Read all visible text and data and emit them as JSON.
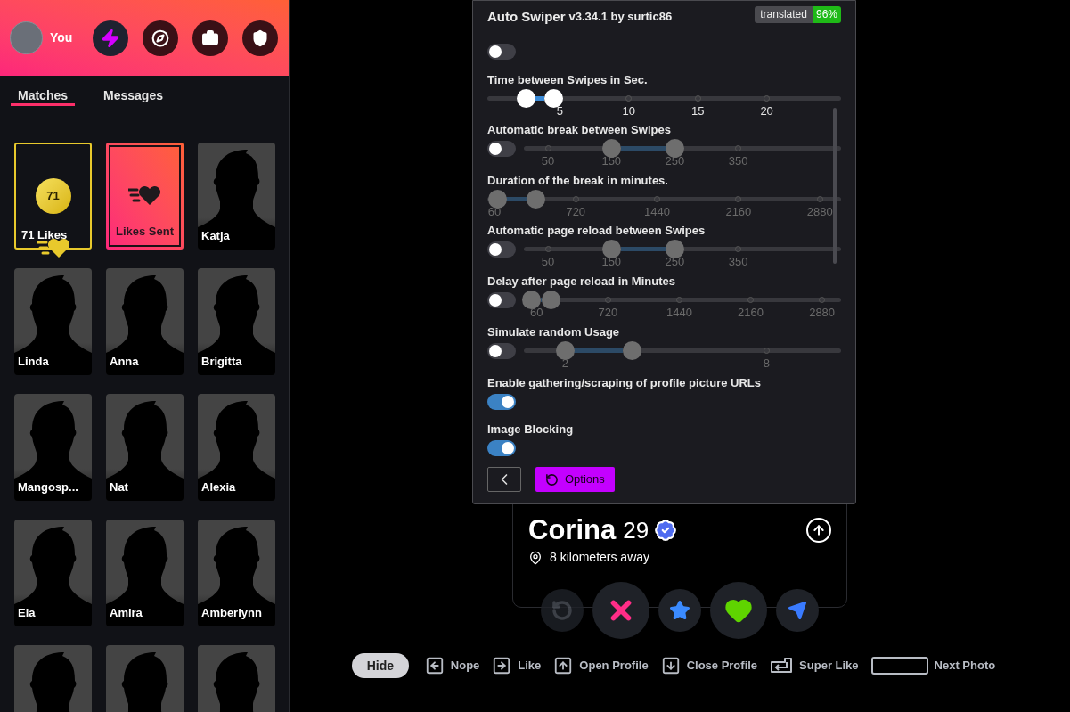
{
  "sidebar": {
    "profile": {
      "name": "You"
    },
    "nav_buttons": [
      {
        "kind": "bolt",
        "selected": true
      },
      {
        "kind": "compass",
        "selected": false
      },
      {
        "kind": "briefcase",
        "selected": false
      },
      {
        "kind": "shield",
        "selected": false
      }
    ],
    "tabs": [
      {
        "label": "Matches",
        "selected": true
      },
      {
        "label": "Messages",
        "selected": false
      }
    ],
    "matches": [
      {
        "kind": "likes",
        "count": "71",
        "label": "71 Likes"
      },
      {
        "kind": "likes_sent",
        "label": "Likes Sent"
      },
      {
        "kind": "person",
        "name": "Katja"
      },
      {
        "kind": "person",
        "name": "Linda"
      },
      {
        "kind": "person",
        "name": "Anna"
      },
      {
        "kind": "person",
        "name": "Brigitta"
      },
      {
        "kind": "person",
        "name": "Mangosp..."
      },
      {
        "kind": "person",
        "name": "Nat"
      },
      {
        "kind": "person",
        "name": "Alexia"
      },
      {
        "kind": "person",
        "name": "Ela"
      },
      {
        "kind": "person",
        "name": "Amira"
      },
      {
        "kind": "person",
        "name": "Amberlynn"
      },
      {
        "kind": "person"
      },
      {
        "kind": "person"
      },
      {
        "kind": "person"
      }
    ]
  },
  "auto_swiper": {
    "title": "Auto Swiper",
    "byline": "v3.34.1 by surtic86",
    "badge": {
      "label": "translated",
      "value": "96%"
    },
    "enabled": false,
    "settings": [
      {
        "kind": "slider",
        "label": "Time between Swipes in Sec.",
        "disabled": false,
        "thumbs": [
          {
            "level": 0.109
          },
          {
            "level": 0.187
          }
        ],
        "ticks": [
          "5",
          "10",
          "15",
          "20"
        ]
      },
      {
        "kind": "toggle_slider",
        "label": "Automatic break between Swipes",
        "on": false,
        "thumbs": [
          {
            "level": 0.277
          },
          {
            "level": 0.477
          }
        ],
        "ticks": [
          "50",
          "150",
          "250",
          "350"
        ]
      },
      {
        "kind": "slider",
        "label": "Duration of the break in minutes.",
        "disabled": true,
        "thumbs": [
          {
            "level": 0.028
          },
          {
            "level": 0.137
          }
        ],
        "ticks": [
          "60",
          "720",
          "1440",
          "2160",
          "2880"
        ]
      },
      {
        "kind": "toggle_slider",
        "label": "Automatic page reload between Swipes",
        "on": false,
        "thumbs": [
          {
            "level": 0.277
          },
          {
            "level": 0.477
          }
        ],
        "ticks": [
          "50",
          "150",
          "250",
          "350"
        ]
      },
      {
        "kind": "toggle_slider",
        "label": "Delay after page reload in Minutes",
        "on": false,
        "thumbs": [
          {
            "level": 0.025
          },
          {
            "level": 0.085
          }
        ],
        "ticks": [
          "60",
          "720",
          "1440",
          "2160",
          "2880"
        ]
      },
      {
        "kind": "toggle_slider",
        "label": "Simulate random Usage",
        "on": false,
        "thumbs": [
          {
            "level": 0.13
          },
          {
            "level": 0.34
          }
        ],
        "ticks": [
          "2",
          "8"
        ]
      },
      {
        "kind": "toggle",
        "label": "Enable gathering/scraping of profile picture URLs",
        "on": true
      },
      {
        "kind": "toggle",
        "label": "Image Blocking",
        "on": true
      }
    ],
    "options_button": "Options"
  },
  "profile_card": {
    "name": "Corina",
    "age": "29",
    "verified": true,
    "distance": "8 kilometers away"
  },
  "actions": [
    {
      "kind": "rewind",
      "disabled": true
    },
    {
      "kind": "nope",
      "disabled": false
    },
    {
      "kind": "super_like",
      "disabled": false
    },
    {
      "kind": "like",
      "disabled": false
    },
    {
      "kind": "boost",
      "disabled": false
    }
  ],
  "shortcuts": {
    "hide_button": "Hide",
    "keys": [
      {
        "kind": "left",
        "label": "Nope"
      },
      {
        "kind": "right",
        "label": "Like"
      },
      {
        "kind": "up",
        "label": "Open Profile"
      },
      {
        "kind": "down",
        "label": "Close Profile"
      },
      {
        "kind": "enter",
        "label": "Super Like"
      },
      {
        "kind": "space",
        "label": "Next Photo"
      }
    ]
  }
}
